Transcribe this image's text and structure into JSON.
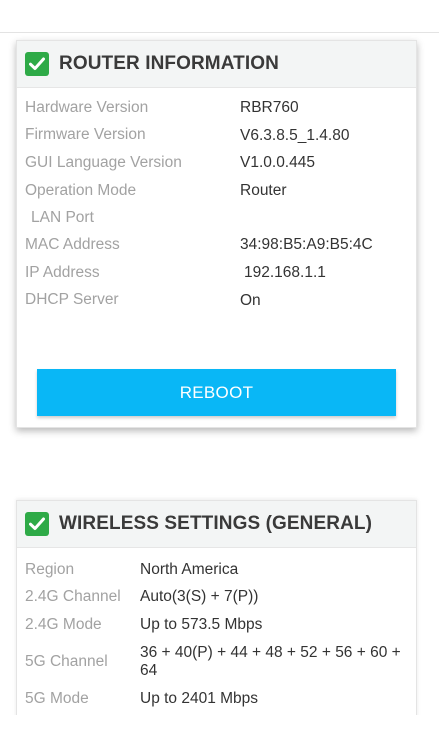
{
  "router_info": {
    "title": "ROUTER INFORMATION",
    "rows": [
      {
        "label": "Hardware Version",
        "value": "RBR760"
      },
      {
        "label": "Firmware Version",
        "value": "V6.3.8.5_1.4.80"
      },
      {
        "label": "GUI Language Version",
        "value": "V1.0.0.445"
      },
      {
        "label": "Operation Mode",
        "value": "Router"
      },
      {
        "label": "LAN Port",
        "value": ""
      },
      {
        "label": "MAC Address",
        "value": "34:98:B5:A9:B5:4C"
      },
      {
        "label": "IP Address",
        "value": "192.168.1.1"
      },
      {
        "label": "DHCP Server",
        "value": "On"
      }
    ],
    "reboot_label": "REBOOT"
  },
  "wireless_settings": {
    "title": "WIRELESS SETTINGS (GENERAL)",
    "rows": [
      {
        "label": "Region",
        "value": "North America"
      },
      {
        "label": "2.4G Channel",
        "value": "Auto(3(S) + 7(P))"
      },
      {
        "label": "2.4G Mode",
        "value": "Up to 573.5 Mbps"
      },
      {
        "label": "5G Channel",
        "value_line1": "36 + 40(P) + 44 + 48 + 52 + 56 + 60 +",
        "value_line2": "64"
      },
      {
        "label": "5G Mode",
        "value": "Up to 2401 Mbps"
      }
    ]
  },
  "colors": {
    "accent": "#09b7f6",
    "check_green": "#2eaa47",
    "label_gray": "#a2a2a2",
    "value_dark": "#333333"
  },
  "icons": {
    "header_check": "check-icon"
  }
}
